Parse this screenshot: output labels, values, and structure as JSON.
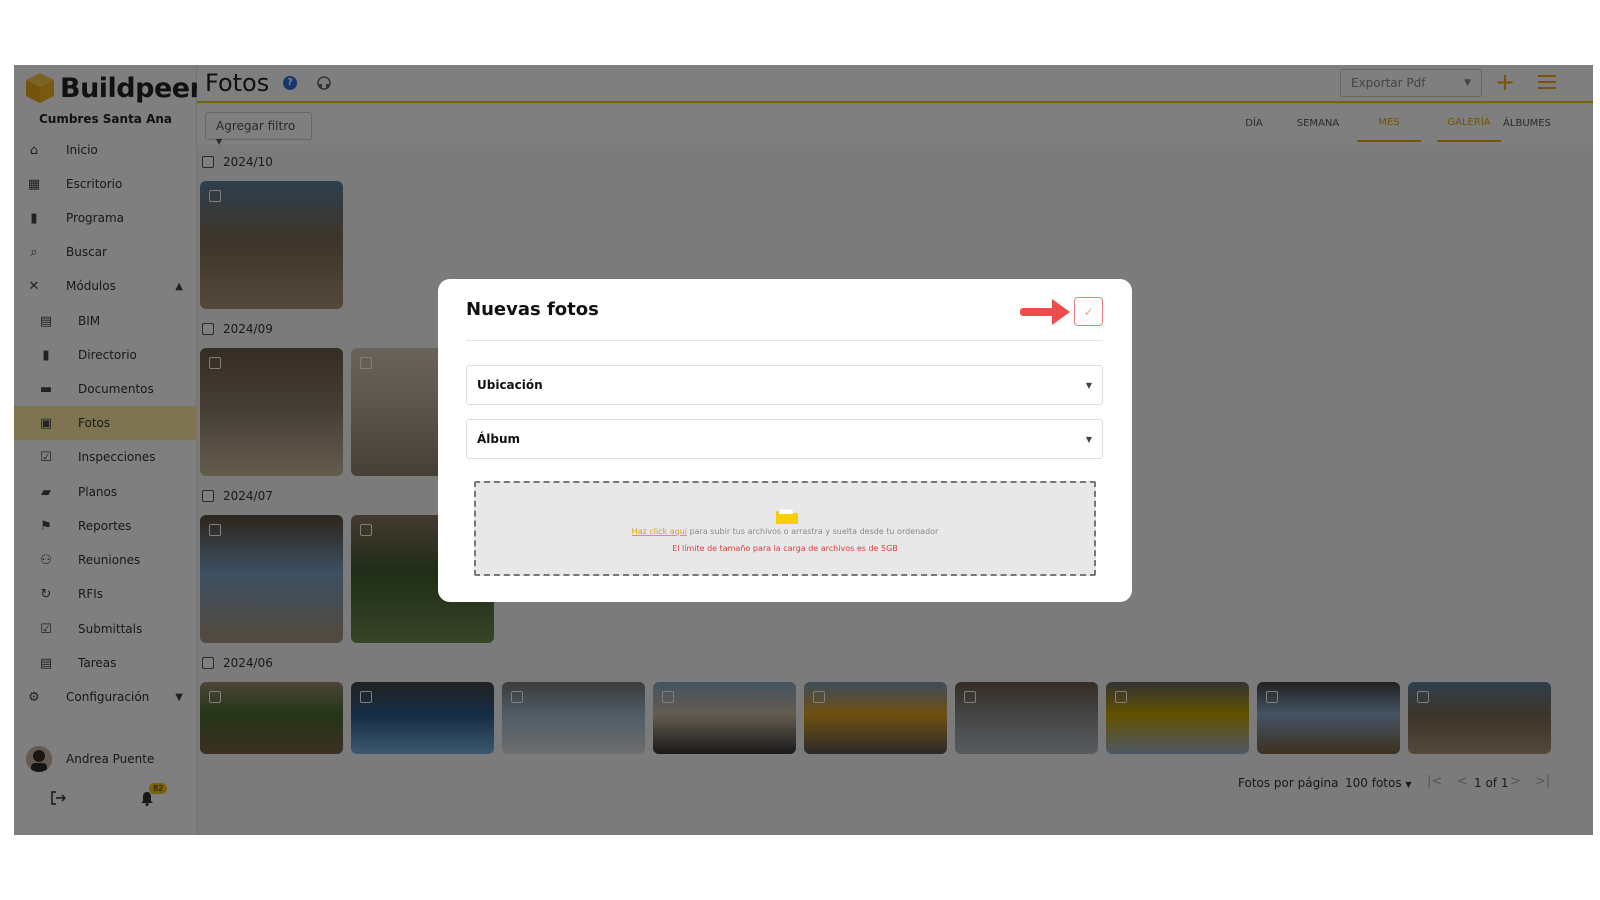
{
  "app": {
    "brand": "Buildpeer",
    "project": "Cumbres Santa Ana"
  },
  "sidebar": {
    "items": [
      {
        "label": "Inicio",
        "icon": "home-icon"
      },
      {
        "label": "Escritorio",
        "icon": "grid-icon"
      },
      {
        "label": "Programa",
        "icon": "chart-icon"
      },
      {
        "label": "Buscar",
        "icon": "search-icon"
      },
      {
        "label": "Módulos",
        "icon": "tools-icon",
        "expanded": true
      },
      {
        "label": "BIM",
        "icon": "bim-icon"
      },
      {
        "label": "Directorio",
        "icon": "book-icon"
      },
      {
        "label": "Documentos",
        "icon": "folder-icon"
      },
      {
        "label": "Fotos",
        "icon": "image-icon",
        "active": true
      },
      {
        "label": "Inspecciones",
        "icon": "checklist-icon"
      },
      {
        "label": "Planos",
        "icon": "blueprint-icon"
      },
      {
        "label": "Reportes",
        "icon": "flag-icon"
      },
      {
        "label": "Reuniones",
        "icon": "people-icon"
      },
      {
        "label": "RFIs",
        "icon": "refresh-icon"
      },
      {
        "label": "Submittals",
        "icon": "clipboard-check-icon"
      },
      {
        "label": "Tareas",
        "icon": "task-icon"
      },
      {
        "label": "Configuración",
        "icon": "settings-icon",
        "expanded": false
      }
    ],
    "user": {
      "name": "Andrea Puente"
    },
    "notifications": "82"
  },
  "header": {
    "title": "Fotos",
    "export_placeholder": "Exportar Pdf"
  },
  "filters": {
    "add_filter": "Agregar filtro"
  },
  "tabs": {
    "period": [
      "DÍA",
      "SEMANA",
      "MES"
    ],
    "period_active": "MES",
    "view": [
      "GALERÍA",
      "ÁLBUMES"
    ],
    "view_active": "GALERÍA"
  },
  "gallery": {
    "groups": [
      {
        "label": "2024/10",
        "count": 1
      },
      {
        "label": "2024/09",
        "count": 2
      },
      {
        "label": "2024/07",
        "count": 2
      },
      {
        "label": "2024/06",
        "count": 9
      }
    ]
  },
  "pager": {
    "per_page_label": "Fotos por página",
    "per_page_value": "100 fotos",
    "page_info": "1 of 1"
  },
  "modal": {
    "title": "Nuevas fotos",
    "location_label": "Ubicación",
    "album_label": "Álbum",
    "upload_link": "Haz click aquí",
    "upload_text": " para subir tus archivos o arrastra y suelta desde tu ordenador",
    "upload_limit": "El límite de tamaño para la carga de archivos es de 5GB"
  },
  "colors": {
    "accent": "#f5c518",
    "arrow": "#ee4d4d",
    "limit_text": "#e23b3b"
  }
}
